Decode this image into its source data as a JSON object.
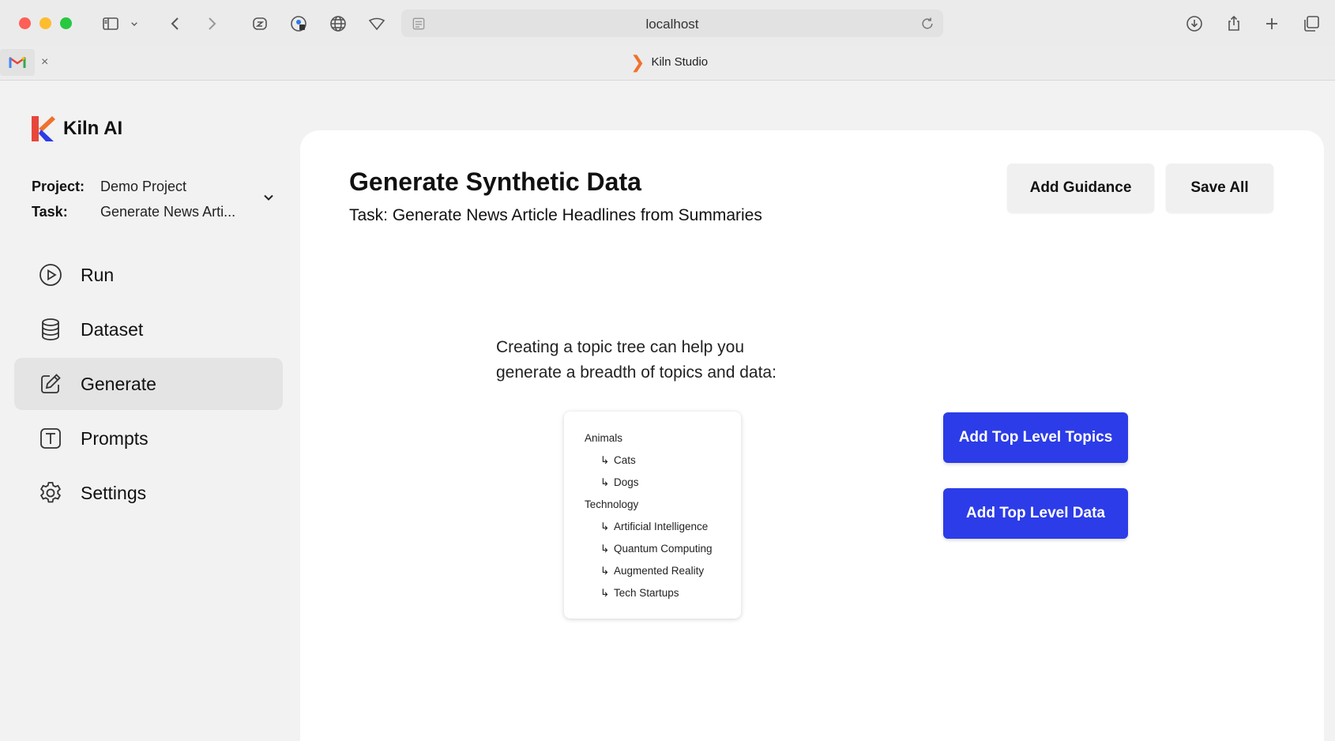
{
  "browser": {
    "url": "localhost",
    "tab_title": "Kiln Studio",
    "tab_close": "×"
  },
  "sidebar": {
    "brand": "Kiln AI",
    "project_label": "Project:",
    "project_value": "Demo Project",
    "task_label": "Task:",
    "task_value": "Generate News Arti...",
    "nav": [
      {
        "label": "Run",
        "icon": "play-circle-icon",
        "active": false
      },
      {
        "label": "Dataset",
        "icon": "database-icon",
        "active": false
      },
      {
        "label": "Generate",
        "icon": "edit-icon",
        "active": true
      },
      {
        "label": "Prompts",
        "icon": "text-box-icon",
        "active": false
      },
      {
        "label": "Settings",
        "icon": "gear-icon",
        "active": false
      }
    ]
  },
  "main": {
    "title": "Generate Synthetic Data",
    "subtitle": "Task: Generate News Article Headlines from Summaries",
    "add_guidance": "Add Guidance",
    "save_all": "Save All",
    "explain_line1": "Creating a topic tree can help you",
    "explain_line2": "generate a breadth of topics and data:",
    "tree_arrow": "↳",
    "tree": [
      {
        "label": "Animals",
        "children": [
          "Cats",
          "Dogs"
        ]
      },
      {
        "label": "Technology",
        "children": [
          "Artificial Intelligence",
          "Quantum Computing",
          "Augmented Reality",
          "Tech Startups"
        ]
      }
    ],
    "add_topics": "Add Top Level Topics",
    "add_data": "Add Top Level Data"
  },
  "colors": {
    "primary": "#2c3ce8",
    "active_nav": "#e4e4e4",
    "brand_orange": "#f0712c",
    "brand_blue": "#2c3ce8",
    "brand_red": "#e8463a"
  }
}
